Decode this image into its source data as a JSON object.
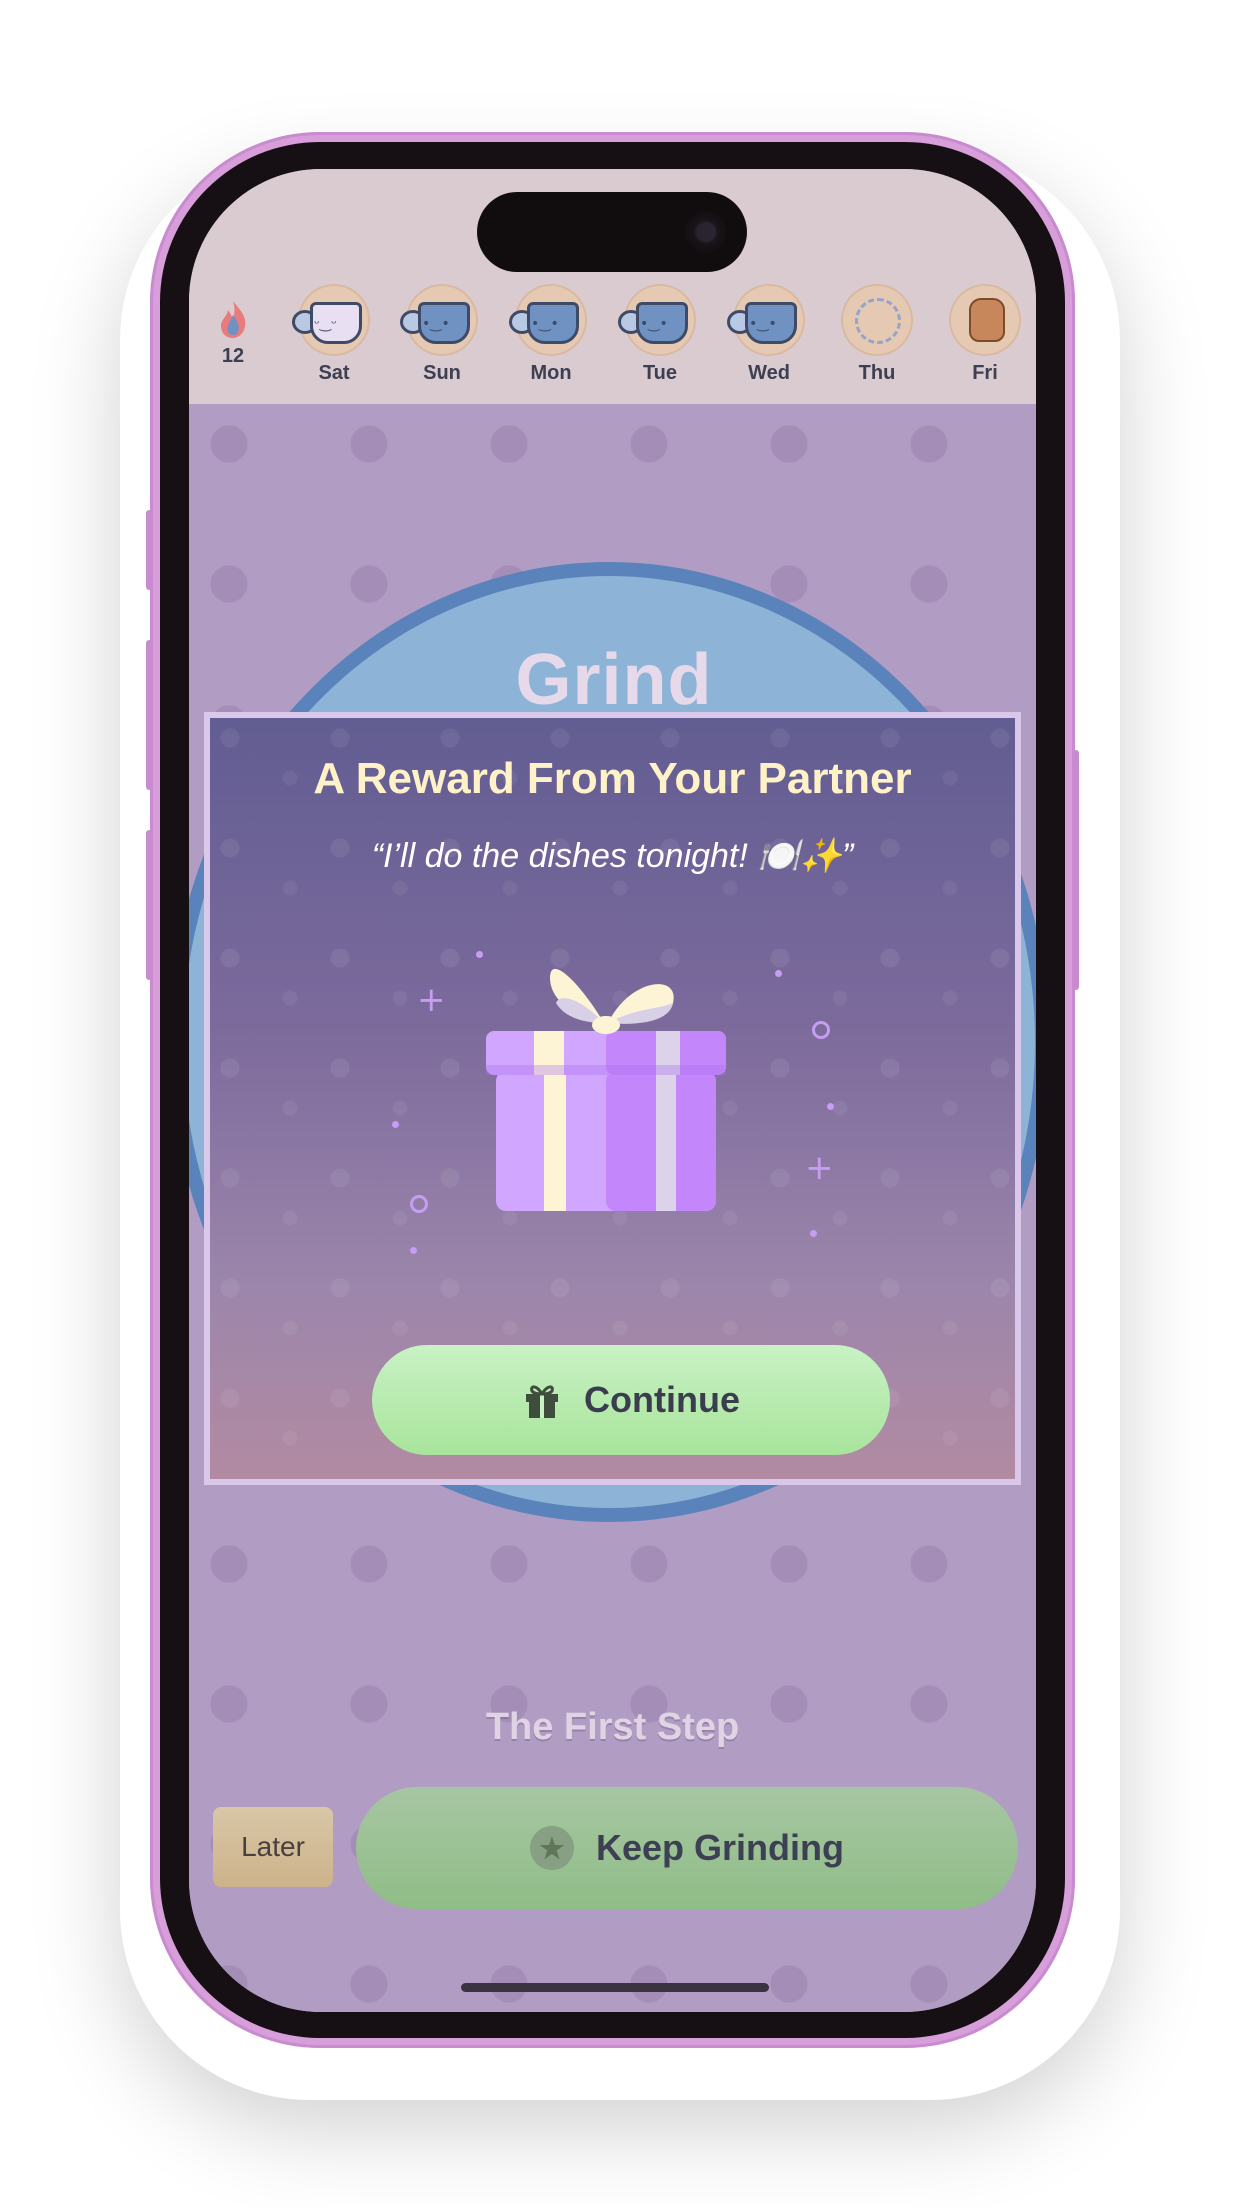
{
  "streak": {
    "count": "12",
    "icon": "flame-icon"
  },
  "days": [
    {
      "label": "Sat",
      "state": "completed-special"
    },
    {
      "label": "Sun",
      "state": "completed"
    },
    {
      "label": "Mon",
      "state": "completed"
    },
    {
      "label": "Tue",
      "state": "completed"
    },
    {
      "label": "Wed",
      "state": "completed"
    },
    {
      "label": "Thu",
      "state": "pending"
    },
    {
      "label": "Fri",
      "state": "reward"
    }
  ],
  "background": {
    "heading": "Grind Complete",
    "subtitle": "The First Step"
  },
  "modal": {
    "title": "A Reward From Your Partner",
    "quote": "“I’ll do the dishes tonight! 🍽️✨”",
    "continue_label": "Continue",
    "continue_icon": "gift-icon"
  },
  "actions": {
    "later_label": "Later",
    "keep_label": "Keep Grinding",
    "keep_icon": "star-icon"
  },
  "colors": {
    "frame": "#d79ed9",
    "modal_title": "#fff2c8",
    "continue_button": "#b5eaab",
    "gift_primary": "#c387fb",
    "gift_ribbon": "#fdf4d6"
  }
}
